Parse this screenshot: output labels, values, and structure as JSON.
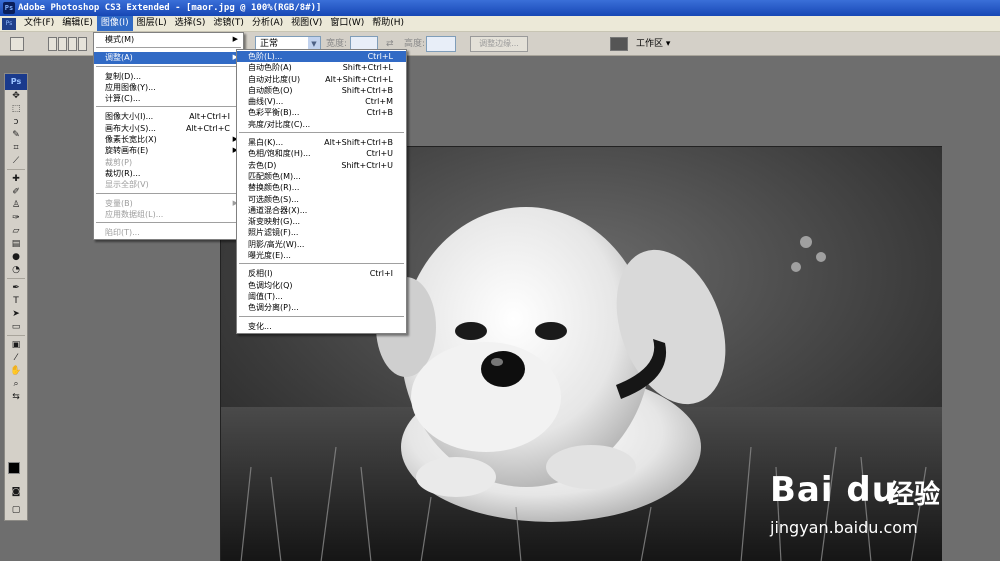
{
  "titlebar": {
    "title": "Adobe Photoshop CS3 Extended - [maor.jpg @ 100%(RGB/8#)]",
    "app_icon": "Ps"
  },
  "menubar": {
    "items": [
      {
        "label": "文件(F)"
      },
      {
        "label": "编辑(E)"
      },
      {
        "label": "图像(I)",
        "active": true
      },
      {
        "label": "图层(L)"
      },
      {
        "label": "选择(S)"
      },
      {
        "label": "滤镜(T)"
      },
      {
        "label": "分析(A)"
      },
      {
        "label": "视图(V)"
      },
      {
        "label": "窗口(W)"
      },
      {
        "label": "帮助(H)"
      }
    ]
  },
  "options": {
    "mode_value": "正常",
    "width_label": "宽度:",
    "height_label": "高度:",
    "refine_label": "调整边缘...",
    "workspace_label": "工作区 ▾"
  },
  "toolbox": {
    "logo": "Ps"
  },
  "image_menu": {
    "groups": [
      [
        {
          "label": "模式(M)",
          "sub": true
        }
      ],
      [
        {
          "label": "调整(A)",
          "sub": true,
          "highlighted": true
        }
      ],
      [
        {
          "label": "复制(D)..."
        },
        {
          "label": "应用图像(Y)..."
        },
        {
          "label": "计算(C)..."
        }
      ],
      [
        {
          "label": "图像大小(I)...",
          "shortcut": "Alt+Ctrl+I"
        },
        {
          "label": "画布大小(S)...",
          "shortcut": "Alt+Ctrl+C"
        },
        {
          "label": "像素长宽比(X)",
          "sub": true
        },
        {
          "label": "旋转画布(E)",
          "sub": true
        },
        {
          "label": "裁剪(P)",
          "disabled": true
        },
        {
          "label": "裁切(R)..."
        },
        {
          "label": "显示全部(V)",
          "disabled": true
        }
      ],
      [
        {
          "label": "变量(B)",
          "sub": true,
          "disabled": true
        },
        {
          "label": "应用数据组(L)...",
          "disabled": true
        }
      ],
      [
        {
          "label": "陷印(T)...",
          "disabled": true
        }
      ]
    ]
  },
  "adjust_menu": {
    "groups": [
      [
        {
          "label": "色阶(L)...",
          "shortcut": "Ctrl+L",
          "highlighted": true
        },
        {
          "label": "自动色阶(A)",
          "shortcut": "Shift+Ctrl+L"
        },
        {
          "label": "自动对比度(U)",
          "shortcut": "Alt+Shift+Ctrl+L"
        },
        {
          "label": "自动颜色(O)",
          "shortcut": "Shift+Ctrl+B"
        },
        {
          "label": "曲线(V)...",
          "shortcut": "Ctrl+M"
        },
        {
          "label": "色彩平衡(B)...",
          "shortcut": "Ctrl+B"
        },
        {
          "label": "亮度/对比度(C)..."
        }
      ],
      [
        {
          "label": "黑白(K)...",
          "shortcut": "Alt+Shift+Ctrl+B"
        },
        {
          "label": "色相/饱和度(H)...",
          "shortcut": "Ctrl+U"
        },
        {
          "label": "去色(D)",
          "shortcut": "Shift+Ctrl+U"
        },
        {
          "label": "匹配颜色(M)..."
        },
        {
          "label": "替换颜色(R)..."
        },
        {
          "label": "可选颜色(S)..."
        },
        {
          "label": "通道混合器(X)..."
        },
        {
          "label": "渐变映射(G)..."
        },
        {
          "label": "照片滤镜(F)..."
        },
        {
          "label": "阴影/高光(W)..."
        },
        {
          "label": "曝光度(E)..."
        }
      ],
      [
        {
          "label": "反相(I)",
          "shortcut": "Ctrl+I"
        },
        {
          "label": "色调均化(Q)"
        },
        {
          "label": "阈值(T)..."
        },
        {
          "label": "色调分离(P)..."
        }
      ],
      [
        {
          "label": "变化..."
        }
      ]
    ]
  },
  "watermark": {
    "logo": "Bai du",
    "brand": "经验",
    "url": "jingyan.baidu.com"
  },
  "colors": {
    "menu_highlight": "#316ac5",
    "title_bar": "#1747b5",
    "chrome": "#d4d0c8"
  }
}
